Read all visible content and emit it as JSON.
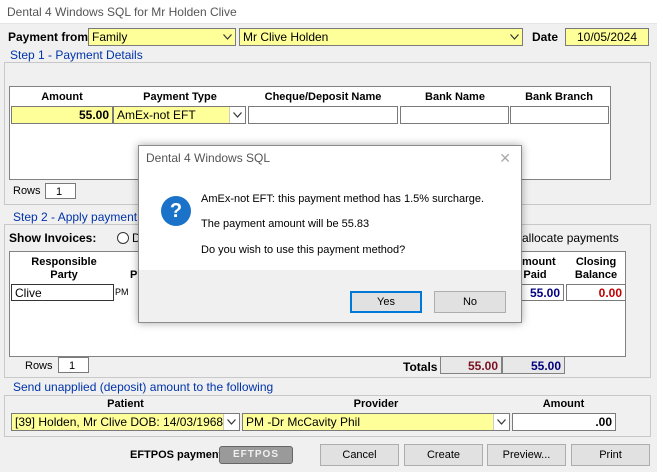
{
  "window": {
    "title": "Dental 4 Windows SQL for Mr  Holden  Clive"
  },
  "payment_from": {
    "label": "Payment from",
    "source": "Family",
    "patient": "Mr Clive  Holden",
    "date_label": "Date",
    "date": "10/05/2024"
  },
  "step1": {
    "title": "Step 1 - Payment Details",
    "headers": [
      "Amount",
      "Payment Type",
      "Cheque/Deposit Name",
      "Bank Name",
      "Bank Branch"
    ],
    "amount": "55.00",
    "payment_type": "AmEx-not EFT",
    "rows_label": "Rows",
    "rows_value": "1"
  },
  "step2": {
    "title": "Step 2 - Apply payment",
    "show_invoices_label": "Show Invoices:",
    "radio_partial": "D",
    "unallocate_label": "allocate payments",
    "headers": {
      "responsible_party_1": "Responsible",
      "responsible_party_2": "Party",
      "p": "P",
      "amount_paid_1": "mount",
      "amount_paid_2": "Paid",
      "closing_balance_1": "Closing",
      "closing_balance_2": "Balance"
    },
    "row": {
      "party": "Clive",
      "p": "PM",
      "paid": "55.00",
      "balance": "0.00"
    },
    "rows_label": "Rows",
    "rows_value": "1",
    "totals_label": "Totals",
    "total_a": "55.00",
    "total_b": "55.00"
  },
  "unapplied": {
    "title": "Send unapplied (deposit) amount to the following",
    "patient_header": "Patient",
    "provider_header": "Provider",
    "amount_header": "Amount",
    "patient": "[39] Holden, Mr Clive DOB: 14/03/1968",
    "provider": "PM -Dr McCavity Phil",
    "amount": ".00"
  },
  "footer": {
    "eftpos_label": "EFTPOS payment",
    "eftpos_logo_text": "EFTPOS",
    "cancel": "Cancel",
    "create": "Create",
    "preview": "Preview...",
    "print": "Print"
  },
  "dialog": {
    "title": "Dental 4 Windows SQL",
    "line1": "AmEx-not EFT: this payment method has 1.5% surcharge.",
    "line2": "The payment amount will be 55.83",
    "line3": "Do you wish to use this payment method?",
    "yes": "Yes",
    "no": "No"
  },
  "colors": {
    "field_yellow": "#ffff99",
    "group_title_blue": "#0033aa",
    "info_icon_blue": "#1a73c8",
    "balance_red": "#c00000",
    "paid_blue": "#000080"
  }
}
